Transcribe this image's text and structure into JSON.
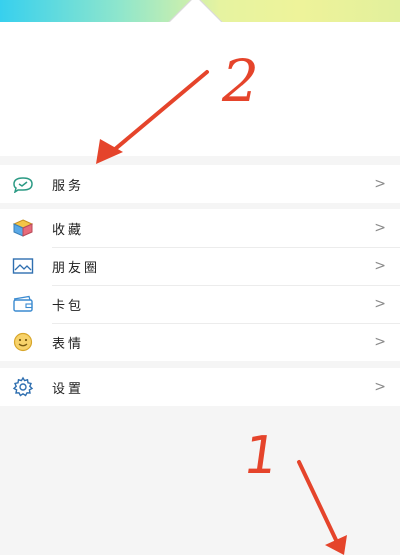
{
  "menu_groups": [
    {
      "items": [
        {
          "icon": "services-icon",
          "label": "服务",
          "chevron": ">"
        }
      ]
    },
    {
      "items": [
        {
          "icon": "favorites-icon",
          "label": "收藏",
          "chevron": ">"
        },
        {
          "icon": "moments-icon",
          "label": "朋友圈",
          "chevron": ">"
        },
        {
          "icon": "cards-icon",
          "label": "卡包",
          "chevron": ">"
        },
        {
          "icon": "stickers-icon",
          "label": "表情",
          "chevron": ">"
        }
      ]
    },
    {
      "items": [
        {
          "icon": "settings-icon",
          "label": "设置",
          "chevron": ">"
        }
      ]
    }
  ],
  "annotations": {
    "number_top": "2",
    "number_bottom": "1",
    "color": "#e5442b"
  },
  "colors": {
    "accent": "#1aad19",
    "annotation": "#e5442b"
  }
}
